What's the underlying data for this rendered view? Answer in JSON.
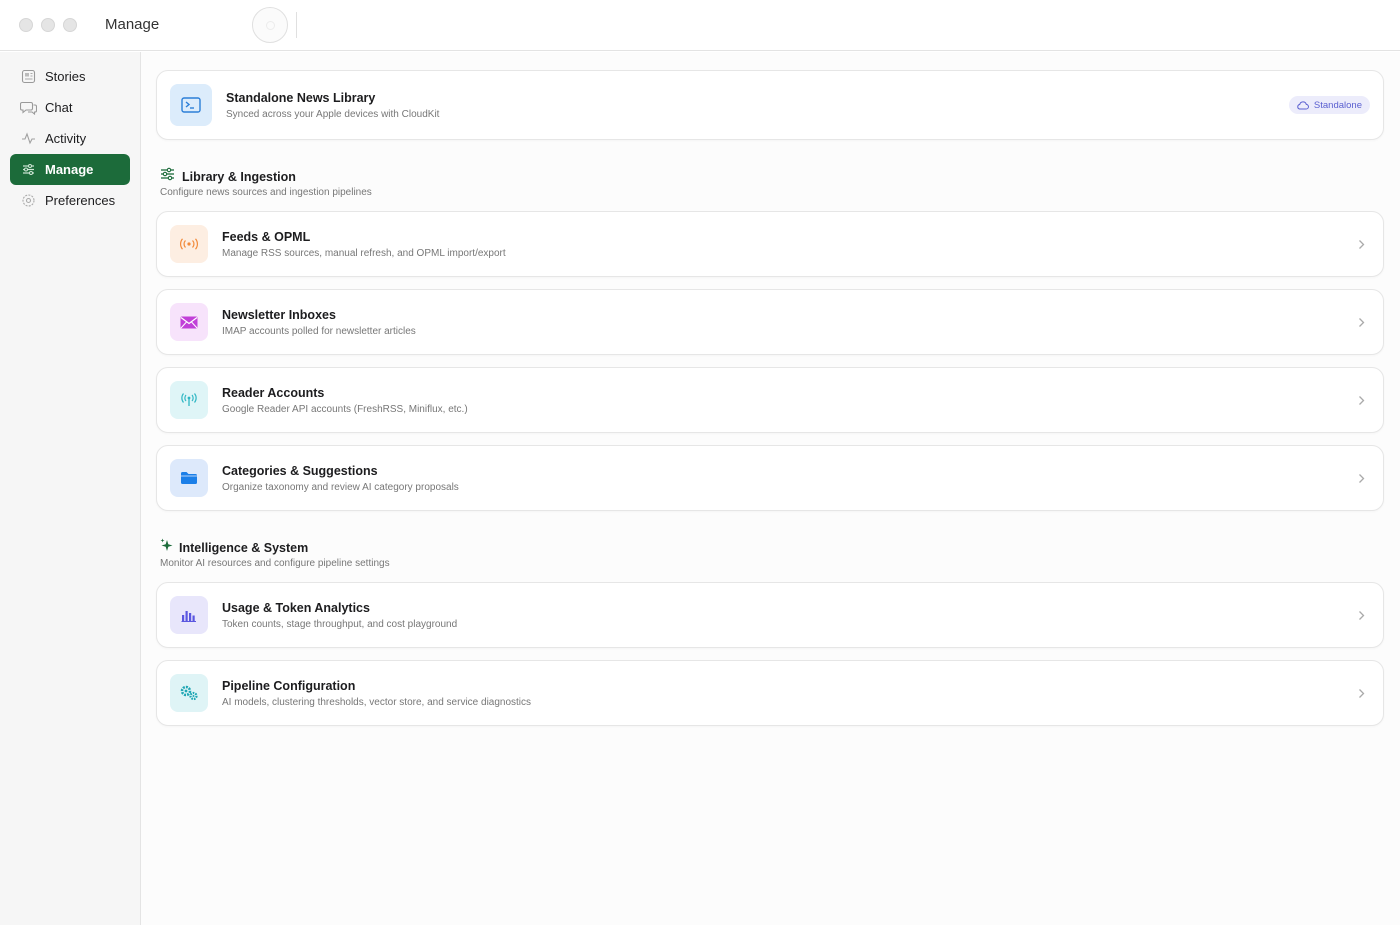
{
  "window": {
    "title": "Manage"
  },
  "sidebar": {
    "items": [
      {
        "label": "Stories",
        "icon": "stories-icon",
        "active": false
      },
      {
        "label": "Chat",
        "icon": "chat-icon",
        "active": false
      },
      {
        "label": "Activity",
        "icon": "activity-icon",
        "active": false
      },
      {
        "label": "Manage",
        "icon": "sliders-icon",
        "active": true
      },
      {
        "label": "Preferences",
        "icon": "gear-icon",
        "active": false
      }
    ]
  },
  "library": {
    "title": "Standalone News Library",
    "subtitle": "Synced across your Apple devices with CloudKit",
    "badge": "Standalone",
    "icon": "terminal-icon"
  },
  "sections": {
    "library_ingestion": {
      "title": "Library & Ingestion",
      "subtitle": "Configure news sources and ingestion pipelines",
      "icon": "sliders-icon",
      "items": [
        {
          "title": "Feeds & OPML",
          "subtitle": "Manage RSS sources, manual refresh, and OPML import/export",
          "icon": "broadcast-icon",
          "color": "#f28b3c"
        },
        {
          "title": "Newsletter Inboxes",
          "subtitle": "IMAP accounts polled for newsletter articles",
          "icon": "envelope-icon",
          "color": "#c13fd8"
        },
        {
          "title": "Reader Accounts",
          "subtitle": "Google Reader API accounts (FreshRSS, Miniflux, etc.)",
          "icon": "antenna-icon",
          "color": "#2fb7c4"
        },
        {
          "title": "Categories & Suggestions",
          "subtitle": "Organize taxonomy and review AI category proposals",
          "icon": "folder-icon",
          "color": "#1b7fe8"
        }
      ]
    },
    "intelligence_system": {
      "title": "Intelligence & System",
      "subtitle": "Monitor AI resources and configure pipeline settings",
      "icon": "sparkles-icon",
      "items": [
        {
          "title": "Usage & Token Analytics",
          "subtitle": "Token counts, stage throughput, and cost playground",
          "icon": "bar-chart-icon",
          "color": "#5b57e0"
        },
        {
          "title": "Pipeline Configuration",
          "subtitle": "AI models, clustering thresholds, vector store, and service diagnostics",
          "icon": "gears-icon",
          "color": "#1fa6b4"
        }
      ]
    }
  },
  "colors": {
    "accent": "#1c6b3a",
    "badge_text": "#5a5fd0",
    "badge_bg": "#ececfb"
  }
}
